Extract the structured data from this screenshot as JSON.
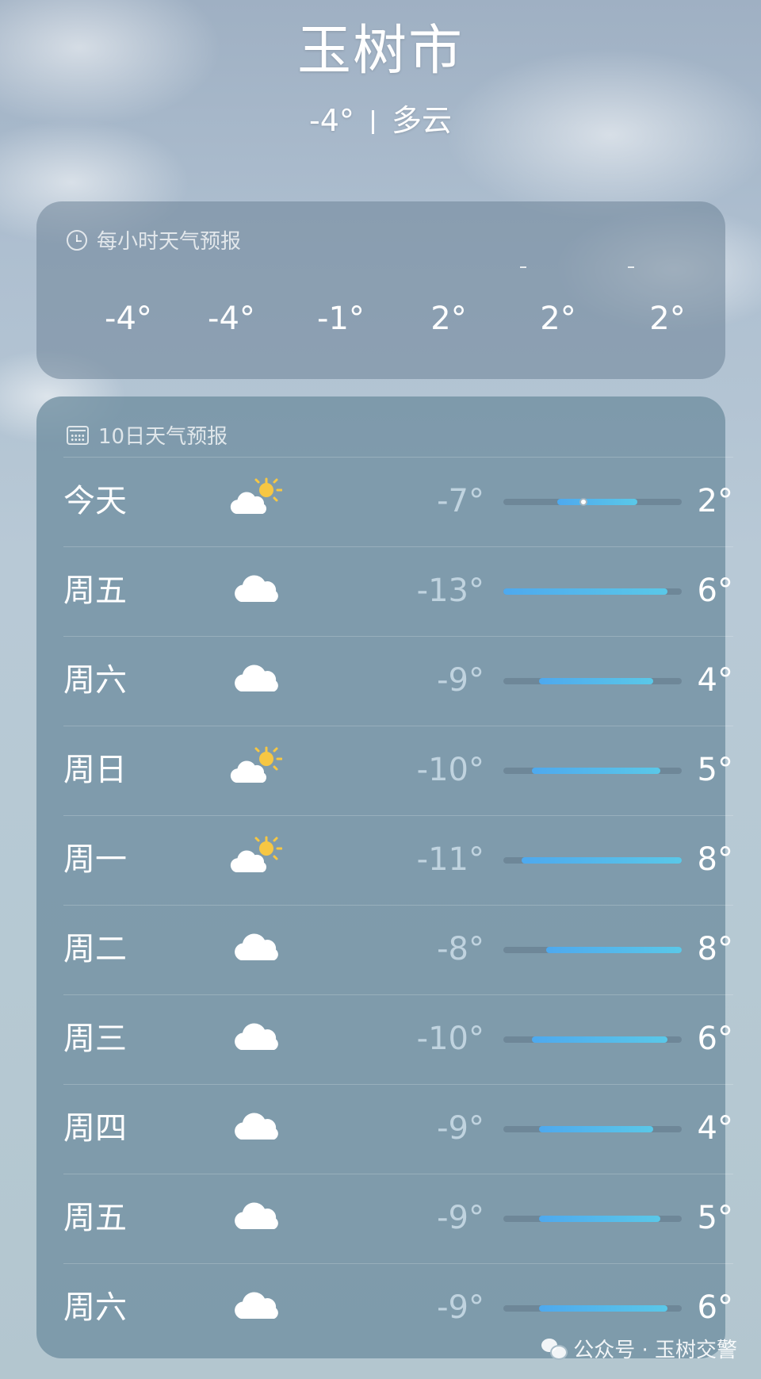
{
  "header": {
    "city": "玉树市",
    "current_temp": "-4°",
    "condition": "多云"
  },
  "hourly": {
    "title": "每小时天气预报",
    "icon": "clock-icon",
    "temps": [
      "-4°",
      "-4°",
      "-1°",
      "2°",
      "2°",
      "2°"
    ]
  },
  "daily": {
    "title": "10日天气预报",
    "icon": "calendar-icon",
    "days": [
      {
        "name": "今天",
        "icon": "partly-cloudy-sun-icon",
        "low": "-7°",
        "high": "2°",
        "bar_start": 0.3,
        "bar_end": 0.75,
        "current_dot": 0.45
      },
      {
        "name": "周五",
        "icon": "cloud-icon",
        "low": "-13°",
        "high": "6°",
        "bar_start": 0.0,
        "bar_end": 0.92
      },
      {
        "name": "周六",
        "icon": "cloud-icon",
        "low": "-9°",
        "high": "4°",
        "bar_start": 0.2,
        "bar_end": 0.84
      },
      {
        "name": "周日",
        "icon": "partly-cloudy-sun-icon",
        "low": "-10°",
        "high": "5°",
        "bar_start": 0.16,
        "bar_end": 0.88
      },
      {
        "name": "周一",
        "icon": "partly-cloudy-sun-icon",
        "low": "-11°",
        "high": "8°",
        "bar_start": 0.1,
        "bar_end": 1.0
      },
      {
        "name": "周二",
        "icon": "cloud-icon",
        "low": "-8°",
        "high": "8°",
        "bar_start": 0.24,
        "bar_end": 1.0
      },
      {
        "name": "周三",
        "icon": "cloud-icon",
        "low": "-10°",
        "high": "6°",
        "bar_start": 0.16,
        "bar_end": 0.92
      },
      {
        "name": "周四",
        "icon": "cloud-icon",
        "low": "-9°",
        "high": "4°",
        "bar_start": 0.2,
        "bar_end": 0.84
      },
      {
        "name": "周五",
        "icon": "cloud-icon",
        "low": "-9°",
        "high": "5°",
        "bar_start": 0.2,
        "bar_end": 0.88
      },
      {
        "name": "周六",
        "icon": "cloud-icon",
        "low": "-9°",
        "high": "6°",
        "bar_start": 0.2,
        "bar_end": 0.92
      }
    ]
  },
  "watermark": {
    "icon": "wechat-icon",
    "text": "公众号 · 玉树交警"
  },
  "colors": {
    "bar_start": "#4ea9ee",
    "bar_end": "#5ac8e8",
    "sun": "#f7c743"
  }
}
